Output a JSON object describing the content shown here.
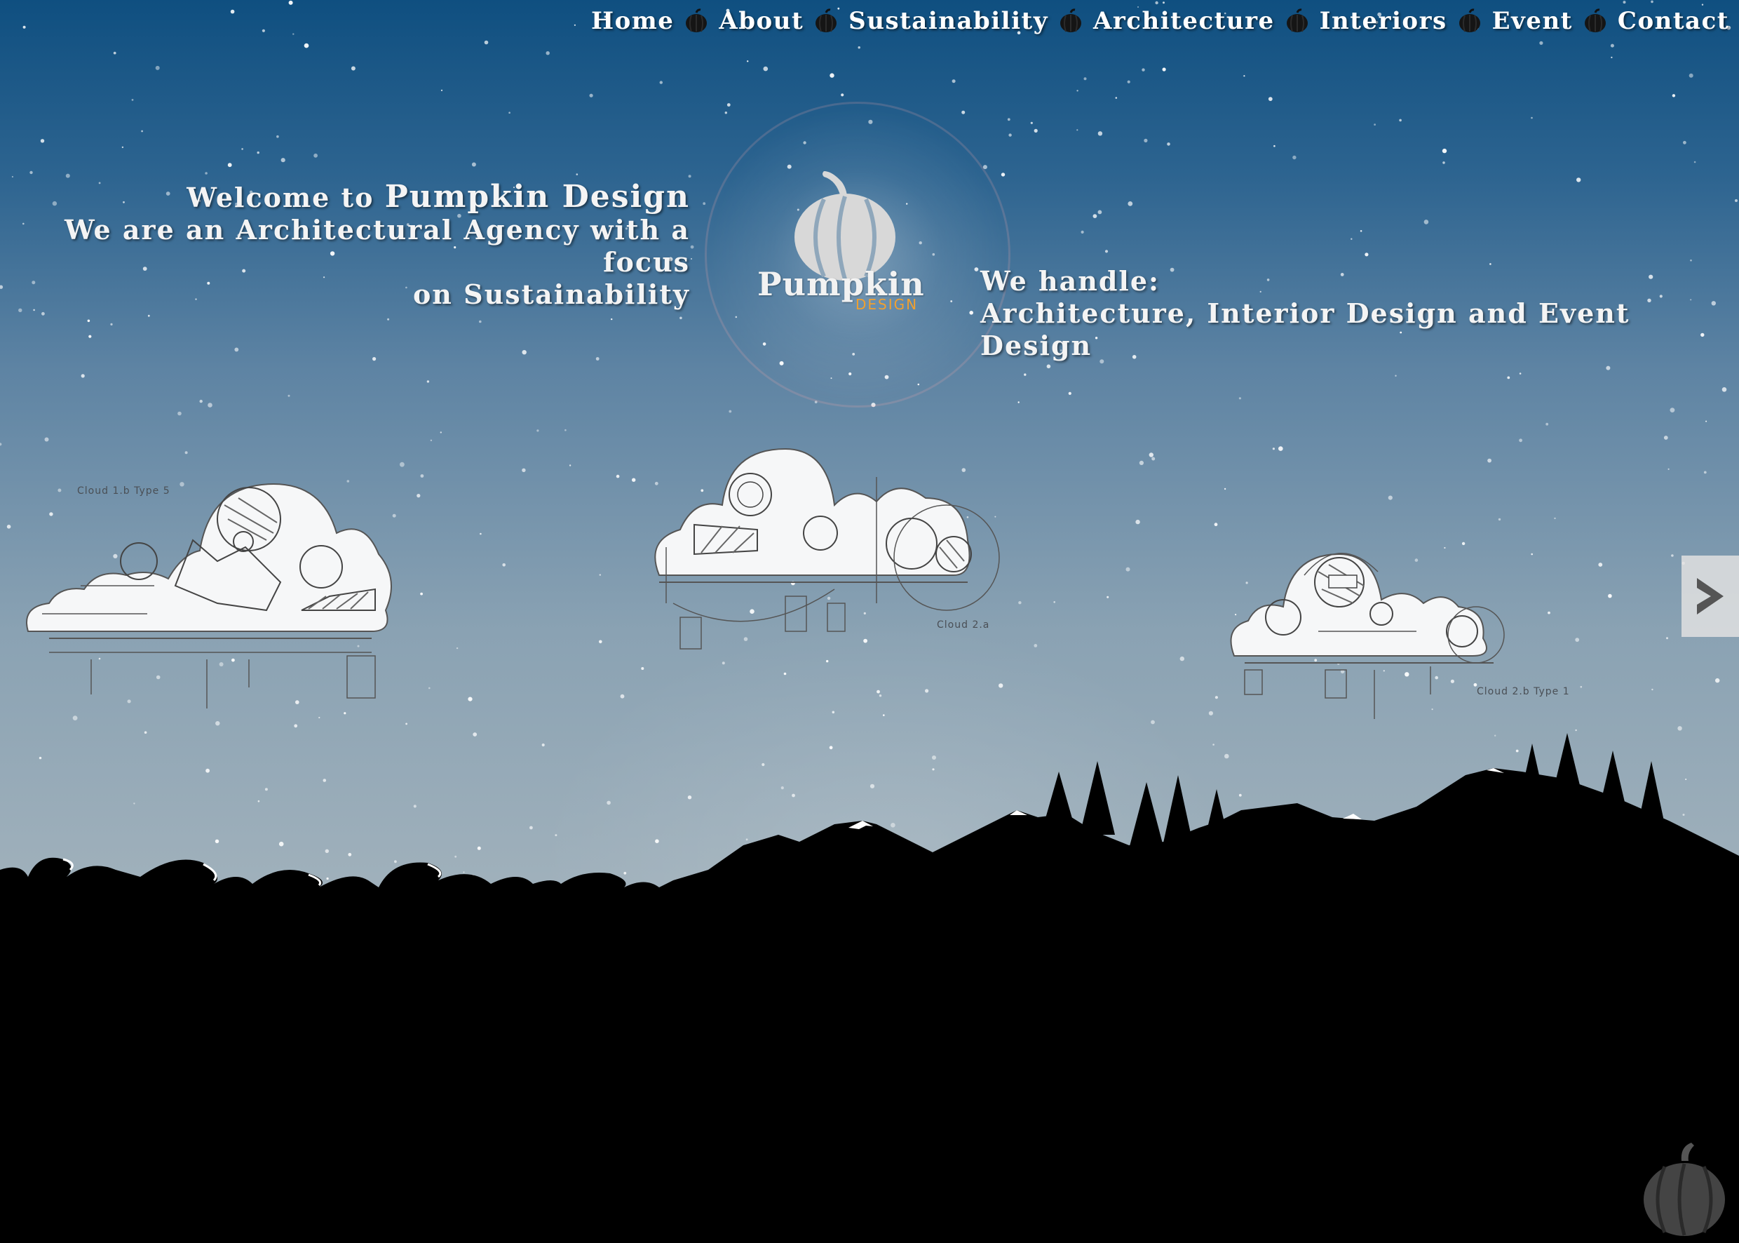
{
  "nav": {
    "items": [
      {
        "label": "Home"
      },
      {
        "label": "About"
      },
      {
        "label": "Sustainability"
      },
      {
        "label": "Architecture"
      },
      {
        "label": "Interiors"
      },
      {
        "label": "Event"
      },
      {
        "label": "Contact"
      }
    ],
    "separator_icon": "pumpkin-icon"
  },
  "intro": {
    "welcome_prefix": "Welcome to",
    "brand": "Pumpkin Design",
    "line2": "We are an Architectural Agency with a focus",
    "line3": "on Sustainability"
  },
  "logo": {
    "word": "Pumpkin",
    "sub": "DESIGN",
    "icon": "pumpkin-icon"
  },
  "services": {
    "heading": "We handle:",
    "list": "Architecture, Interior Design and Event Design"
  },
  "clouds": [
    {
      "label": "Cloud 1.b Type 5"
    },
    {
      "label": "Cloud 2.a"
    },
    {
      "label": "Cloud 2.b Type 1"
    }
  ],
  "controls": {
    "next_icon": "chevron-right-icon",
    "next_glyph": ">"
  },
  "colors": {
    "accent": "#f0a030",
    "text": "#f4f4f4",
    "sky_top": "#0f4f80",
    "ground": "#000000"
  }
}
